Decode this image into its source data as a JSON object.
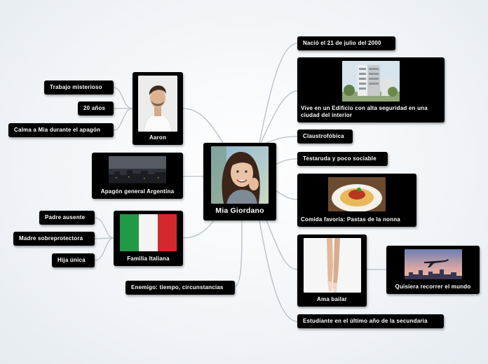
{
  "central": {
    "label": "Mia Giordano",
    "photo_icon": "woman-portrait-image"
  },
  "right": {
    "birth": "Nació el 21 de julio del 2000",
    "building": {
      "label": "Vive en un Edificio con alta seguridad en una ciudad del interior",
      "image": "apartment-building-image"
    },
    "claustro": "Claustrofóbica",
    "stubborn": "Testaruda y poco sociable",
    "food": {
      "label": "Comida favoria: Pastas de la nonna",
      "image": "pasta-plate-image"
    },
    "dance": {
      "label": "Ama bailar",
      "image": "ballet-feet-image"
    },
    "travel": {
      "label": "Quisiera recorrer el mundo",
      "image": "airplane-city-image"
    },
    "student": "Estudiante en el último año de la secundaria"
  },
  "left": {
    "aaron": {
      "label": "Aaron",
      "image": "man-portrait-image",
      "children": [
        "Trabajo misterioso",
        "20 años",
        "Calma a Mia durante el apagón"
      ]
    },
    "blackout": {
      "label": "Apagón general Argentina",
      "image": "dark-city-skyline-image"
    },
    "family": {
      "label": "Familia Italiana",
      "image": "italian-flag-image",
      "children": [
        "Padre ausente",
        "Madre sobreprotectora",
        "Hija única"
      ]
    },
    "enemy": "Enemigo: tiempo, circunstancias"
  },
  "colors": {
    "node_bg": "#000000",
    "connector": "#b6bfc8",
    "flag_green": "#1f9a46",
    "flag_red": "#d2282e"
  }
}
